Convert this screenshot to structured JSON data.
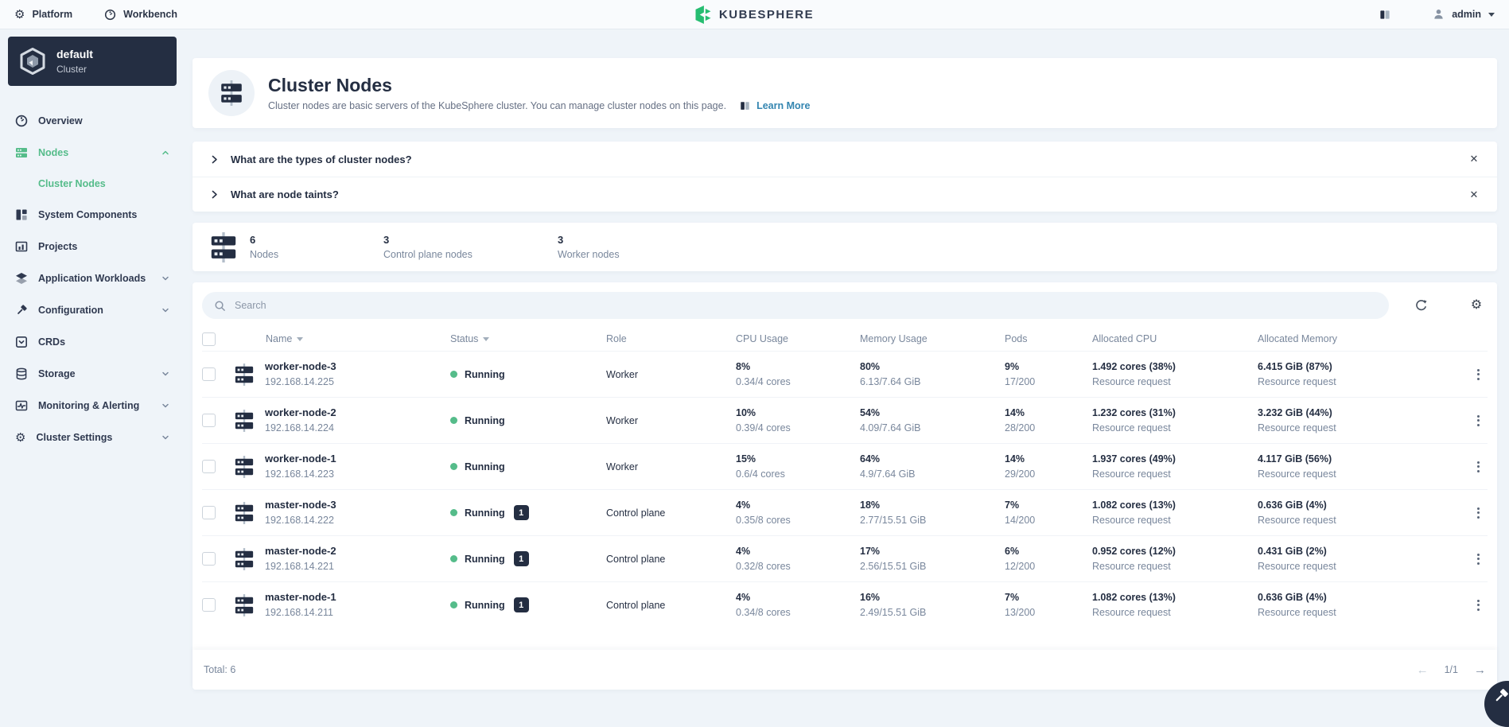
{
  "colors": {
    "accent_green": "#55bc8a",
    "dark_navy": "#242e42",
    "link_blue": "#3385b0",
    "running_dot": "#55bc8a"
  },
  "topbar": {
    "platform": "Platform",
    "workbench": "Workbench",
    "logo": "KUBESPHERE",
    "user": "admin"
  },
  "sidebar": {
    "cluster_name": "default",
    "cluster_kind": "Cluster",
    "items": [
      {
        "label": "Overview"
      },
      {
        "label": "Nodes"
      },
      {
        "label": "Cluster Nodes"
      },
      {
        "label": "System Components"
      },
      {
        "label": "Projects"
      },
      {
        "label": "Application Workloads"
      },
      {
        "label": "Configuration"
      },
      {
        "label": "CRDs"
      },
      {
        "label": "Storage"
      },
      {
        "label": "Monitoring & Alerting"
      },
      {
        "label": "Cluster Settings"
      }
    ]
  },
  "header": {
    "title": "Cluster Nodes",
    "description": "Cluster nodes are basic servers of the KubeSphere cluster. You can manage cluster nodes on this page.",
    "learn_more": "Learn More"
  },
  "faq": {
    "items": [
      {
        "question": "What are the types of cluster nodes?"
      },
      {
        "question": "What are node taints?"
      }
    ]
  },
  "stats": {
    "items": [
      {
        "value": "6",
        "label": "Nodes"
      },
      {
        "value": "3",
        "label": "Control plane nodes"
      },
      {
        "value": "3",
        "label": "Worker nodes"
      }
    ]
  },
  "toolbar": {
    "search_placeholder": "Search"
  },
  "table": {
    "columns": [
      "Name",
      "Status",
      "Role",
      "CPU Usage",
      "Memory Usage",
      "Pods",
      "Allocated CPU",
      "Allocated Memory"
    ],
    "rows": [
      {
        "name": "worker-node-3",
        "ip": "192.168.14.225",
        "status": "Running",
        "taints": "",
        "role": "Worker",
        "cpu": "8%",
        "cpu_sub": "0.34/4 cores",
        "memory": "80%",
        "memory_sub": "6.13/7.64 GiB",
        "pods": "9%",
        "pods_sub": "17/200",
        "alloc_cpu": "1.492 cores (38%)",
        "alloc_cpu_sub": "Resource request",
        "alloc_mem": "6.415 GiB (87%)",
        "alloc_mem_sub": "Resource request"
      },
      {
        "name": "worker-node-2",
        "ip": "192.168.14.224",
        "status": "Running",
        "taints": "",
        "role": "Worker",
        "cpu": "10%",
        "cpu_sub": "0.39/4 cores",
        "memory": "54%",
        "memory_sub": "4.09/7.64 GiB",
        "pods": "14%",
        "pods_sub": "28/200",
        "alloc_cpu": "1.232 cores (31%)",
        "alloc_cpu_sub": "Resource request",
        "alloc_mem": "3.232 GiB (44%)",
        "alloc_mem_sub": "Resource request"
      },
      {
        "name": "worker-node-1",
        "ip": "192.168.14.223",
        "status": "Running",
        "taints": "",
        "role": "Worker",
        "cpu": "15%",
        "cpu_sub": "0.6/4 cores",
        "memory": "64%",
        "memory_sub": "4.9/7.64 GiB",
        "pods": "14%",
        "pods_sub": "29/200",
        "alloc_cpu": "1.937 cores (49%)",
        "alloc_cpu_sub": "Resource request",
        "alloc_mem": "4.117 GiB (56%)",
        "alloc_mem_sub": "Resource request"
      },
      {
        "name": "master-node-3",
        "ip": "192.168.14.222",
        "status": "Running",
        "taints": "1",
        "role": "Control plane",
        "cpu": "4%",
        "cpu_sub": "0.35/8 cores",
        "memory": "18%",
        "memory_sub": "2.77/15.51 GiB",
        "pods": "7%",
        "pods_sub": "14/200",
        "alloc_cpu": "1.082 cores (13%)",
        "alloc_cpu_sub": "Resource request",
        "alloc_mem": "0.636 GiB (4%)",
        "alloc_mem_sub": "Resource request"
      },
      {
        "name": "master-node-2",
        "ip": "192.168.14.221",
        "status": "Running",
        "taints": "1",
        "role": "Control plane",
        "cpu": "4%",
        "cpu_sub": "0.32/8 cores",
        "memory": "17%",
        "memory_sub": "2.56/15.51 GiB",
        "pods": "6%",
        "pods_sub": "12/200",
        "alloc_cpu": "0.952 cores (12%)",
        "alloc_cpu_sub": "Resource request",
        "alloc_mem": "0.431 GiB (2%)",
        "alloc_mem_sub": "Resource request"
      },
      {
        "name": "master-node-1",
        "ip": "192.168.14.211",
        "status": "Running",
        "taints": "1",
        "role": "Control plane",
        "cpu": "4%",
        "cpu_sub": "0.34/8 cores",
        "memory": "16%",
        "memory_sub": "2.49/15.51 GiB",
        "pods": "7%",
        "pods_sub": "13/200",
        "alloc_cpu": "1.082 cores (13%)",
        "alloc_cpu_sub": "Resource request",
        "alloc_mem": "0.636 GiB (4%)",
        "alloc_mem_sub": "Resource request"
      }
    ],
    "footer": {
      "total": "Total: 6",
      "page": "1/1"
    }
  }
}
